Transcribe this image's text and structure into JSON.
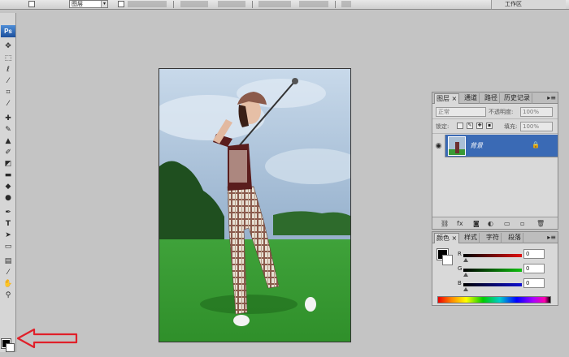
{
  "options_bar": {
    "layer_select": "图层",
    "workspace_label": "工作区"
  },
  "toolbox": {
    "logo": "Ps",
    "tools": [
      "move-tool",
      "marquee-tool",
      "lasso-tool",
      "magic-wand-tool",
      "crop-tool",
      "slice-tool",
      "healing-brush-tool",
      "brush-tool",
      "clone-stamp-tool",
      "history-brush-tool",
      "eraser-tool",
      "gradient-tool",
      "blur-tool",
      "dodge-tool",
      "pen-tool",
      "type-tool",
      "path-selection-tool",
      "shape-tool",
      "notes-tool",
      "eyedropper-tool",
      "hand-tool",
      "zoom-tool"
    ],
    "type_glyph": "T",
    "foreground_color": "#000000",
    "background_color": "#ffffff"
  },
  "annotation": {
    "arrow_color": "#e0202a"
  },
  "layers_panel": {
    "tabs": [
      "图层",
      "通道",
      "路径",
      "历史记录"
    ],
    "blend_mode": "正常",
    "opacity_label": "不透明度:",
    "opacity_value": "100%",
    "lock_label": "锁定:",
    "fill_label": "填充:",
    "fill_value": "100%",
    "layer": {
      "name": "背景",
      "visible": true,
      "locked": true
    }
  },
  "color_panel": {
    "tabs": [
      "颜色",
      "样式",
      "字符",
      "段落"
    ],
    "channels": [
      {
        "label": "R",
        "value": "0",
        "color": "#d01010"
      },
      {
        "label": "G",
        "value": "0",
        "color": "#10b010"
      },
      {
        "label": "B",
        "value": "0",
        "color": "#1010c0"
      }
    ]
  }
}
